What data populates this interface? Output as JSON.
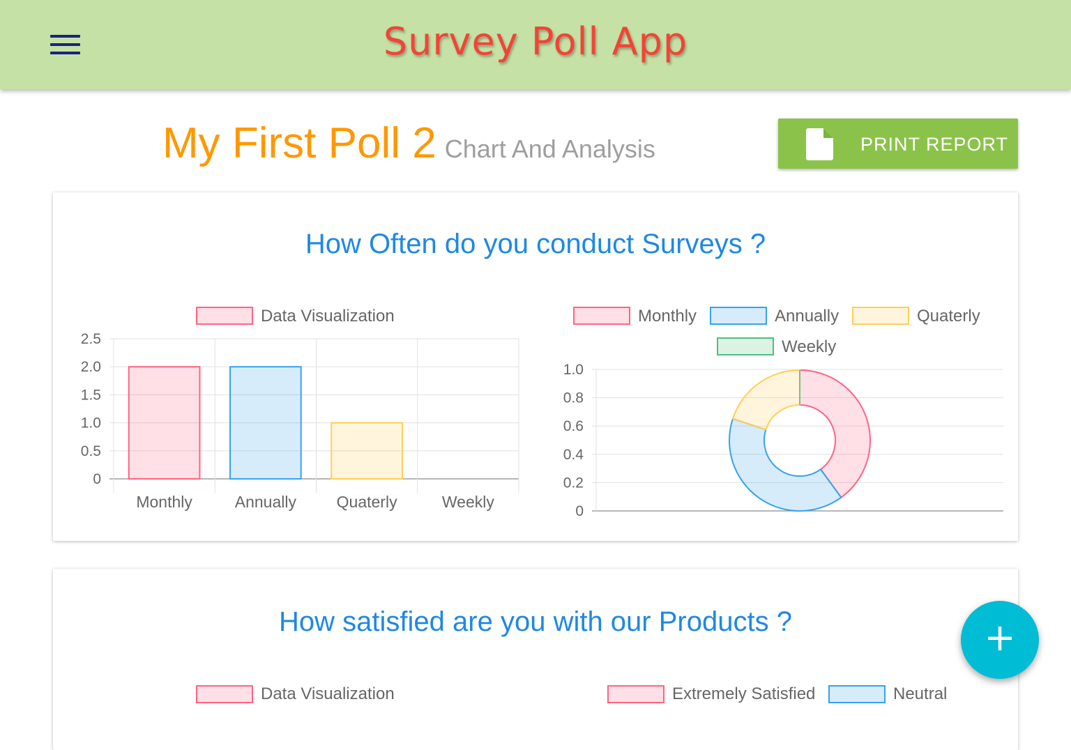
{
  "app": {
    "title": "Survey Poll App"
  },
  "page": {
    "poll_title": "My First Poll 2",
    "subtitle": "Chart And Analysis"
  },
  "actions": {
    "print_label": "PRINT REPORT",
    "fab_label": "+"
  },
  "colors": {
    "header_bg": "#c5e1a5",
    "app_title": "#f44336",
    "poll_title": "#ff9800",
    "print_button": "#8bc34a",
    "question": "#1e88e5",
    "fab": "#00bcd4",
    "series_pink": "#ff6384",
    "series_blue": "#36a2eb",
    "series_yellow": "#ffce56",
    "series_green": "#4bc07c"
  },
  "icons": {
    "menu": "hamburger-menu-icon",
    "print": "file-icon",
    "fab": "plus-icon"
  },
  "questions": [
    {
      "title": "How Often do you conduct Surveys ?",
      "bar_chart": {
        "legend": "Data Visualization",
        "yticks": [
          "2.5",
          "2.0",
          "1.5",
          "1.0",
          "0.5",
          "0"
        ]
      },
      "doughnut_chart": {
        "legend": [
          "Monthly",
          "Annually",
          "Quaterly",
          "Weekly"
        ],
        "yticks": [
          "1.0",
          "0.8",
          "0.6",
          "0.4",
          "0.2",
          "0"
        ]
      }
    },
    {
      "title": "How satisfied are you with our Products ?",
      "bar_chart": {
        "legend": "Data Visualization"
      },
      "doughnut_chart": {
        "legend": [
          "Extremely Satisfied",
          "Neutral"
        ]
      }
    }
  ],
  "chart_data": [
    {
      "type": "bar",
      "categories": [
        "Monthly",
        "Annually",
        "Quaterly",
        "Weekly"
      ],
      "series": [
        {
          "name": "Data Visualization",
          "values": [
            2,
            2,
            1,
            0
          ]
        }
      ],
      "ylim": [
        0,
        2.5
      ],
      "grid": true,
      "legend": "top"
    },
    {
      "type": "pie",
      "categories": [
        "Monthly",
        "Annually",
        "Quaterly",
        "Weekly"
      ],
      "values": [
        2,
        2,
        1,
        0
      ],
      "legend": "top",
      "note_axes": "doughnut drawn over empty 0-1.0 axes"
    }
  ]
}
